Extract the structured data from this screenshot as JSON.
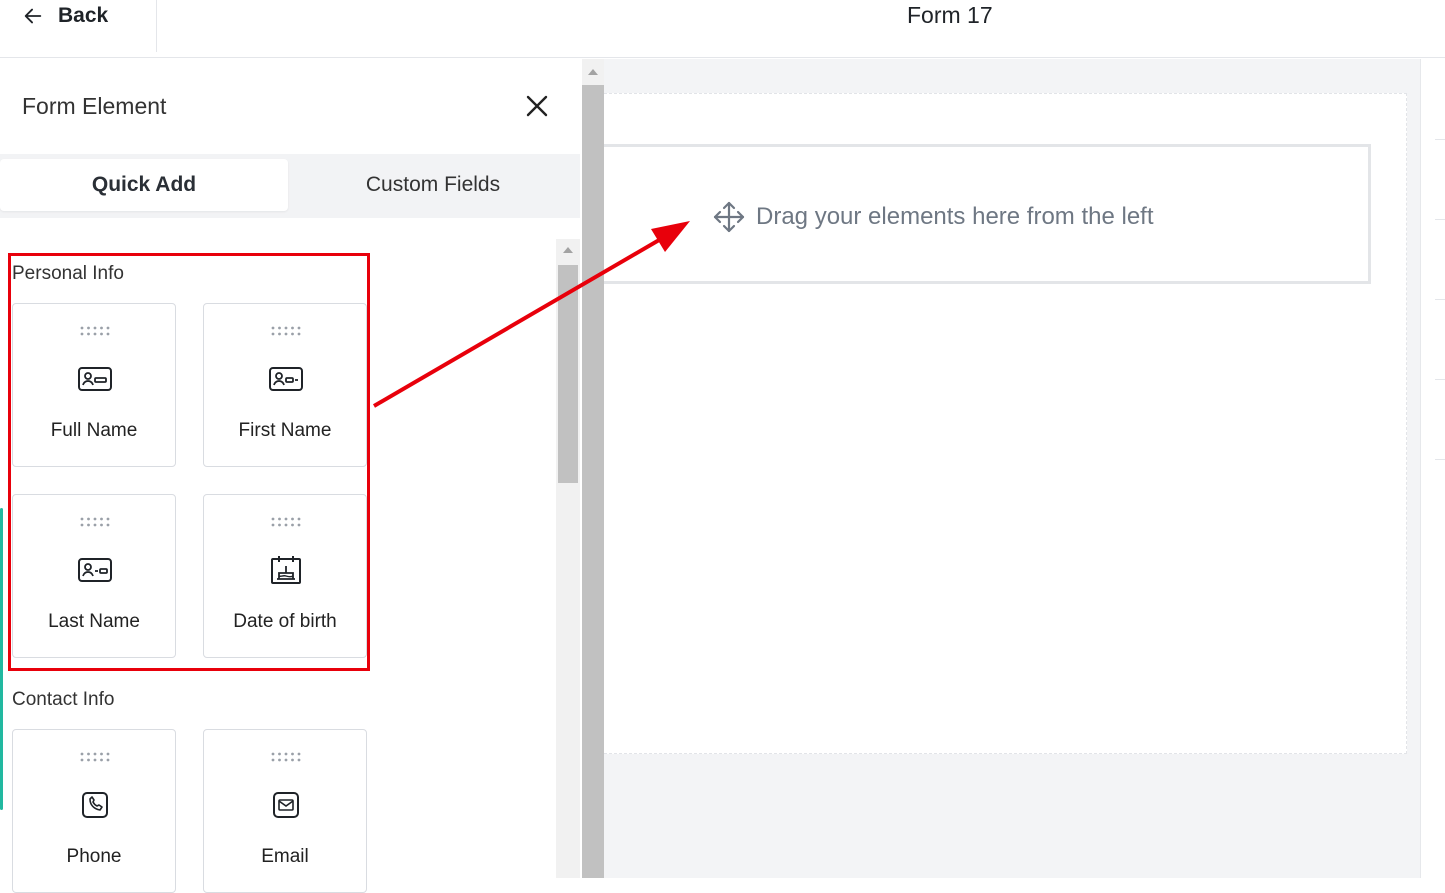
{
  "header": {
    "back_label": "Back",
    "form_title": "Form 17"
  },
  "panel": {
    "title": "Form Element",
    "tabs": [
      {
        "label": "Quick Add",
        "active": true
      },
      {
        "label": "Custom Fields",
        "active": false
      }
    ],
    "sections": [
      {
        "label": "Personal Info",
        "items": [
          {
            "label": "Full Name",
            "icon": "id-card-icon"
          },
          {
            "label": "First Name",
            "icon": "id-card-icon"
          },
          {
            "label": "Last Name",
            "icon": "id-card-icon"
          },
          {
            "label": "Date of birth",
            "icon": "calendar-icon"
          }
        ]
      },
      {
        "label": "Contact Info",
        "items": [
          {
            "label": "Phone",
            "icon": "phone-icon"
          },
          {
            "label": "Email",
            "icon": "email-icon"
          }
        ]
      }
    ]
  },
  "canvas": {
    "drop_hint": "Drag your elements here from the left"
  },
  "colors": {
    "annotation": "#e8000b",
    "canvas_bg": "#f3f4f6",
    "accent_teal": "#21b8a0",
    "hint_text": "#6e7783"
  }
}
